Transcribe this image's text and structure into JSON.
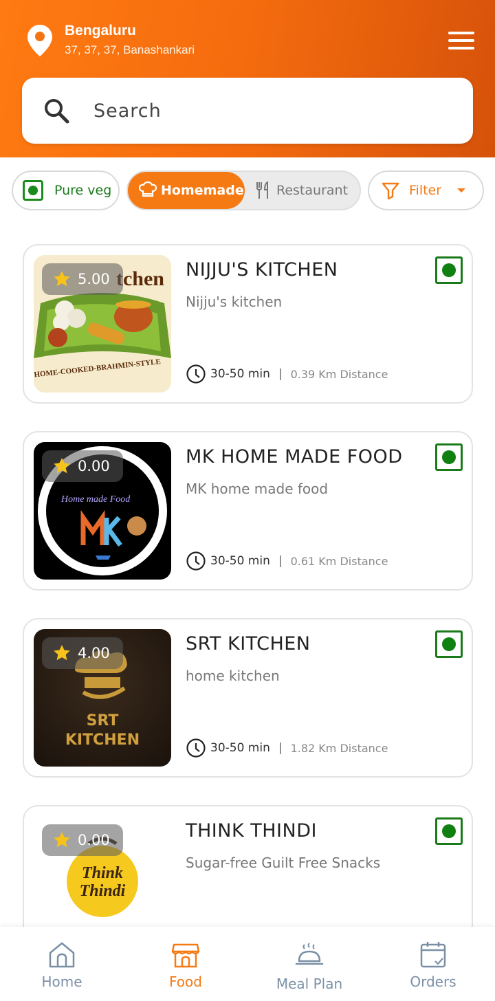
{
  "header": {
    "city": "Bengaluru",
    "address": "37, 37, 37, Banashankari",
    "search_placeholder": "Search"
  },
  "filters": {
    "pure_veg": "Pure veg",
    "homemade": "Homemade",
    "restaurant": "Restaurant",
    "filter": "Filter"
  },
  "colors": {
    "accent": "#f57a14",
    "veg_green": "#1a7a1a"
  },
  "restaurants": [
    {
      "rating": "5.00",
      "name": "NIJJU'S KITCHEN",
      "subtitle": "Nijju's kitchen",
      "time": "30-50 min",
      "distance": "0.39 Km Distance",
      "logo_text": "HOME-COOKED-BRAHMIN-STYLE"
    },
    {
      "rating": "0.00",
      "name": "MK HOME MADE FOOD",
      "subtitle": "MK home made food",
      "time": "30-50 min",
      "distance": "0.61 Km Distance",
      "logo_text": "Home made Food"
    },
    {
      "rating": "4.00",
      "name": "SRT KITCHEN",
      "subtitle": "home kitchen",
      "time": "30-50 min",
      "distance": "1.82 Km Distance",
      "logo_text": "SRT KITCHEN"
    },
    {
      "rating": "0.00",
      "name": "THINK THINDI",
      "subtitle": "Sugar-free Guilt Free Snacks",
      "time": "",
      "distance": "",
      "logo_text": "Think Thindi"
    }
  ],
  "nav": {
    "home": "Home",
    "food": "Food",
    "meal_plan": "Meal Plan",
    "orders": "Orders"
  }
}
